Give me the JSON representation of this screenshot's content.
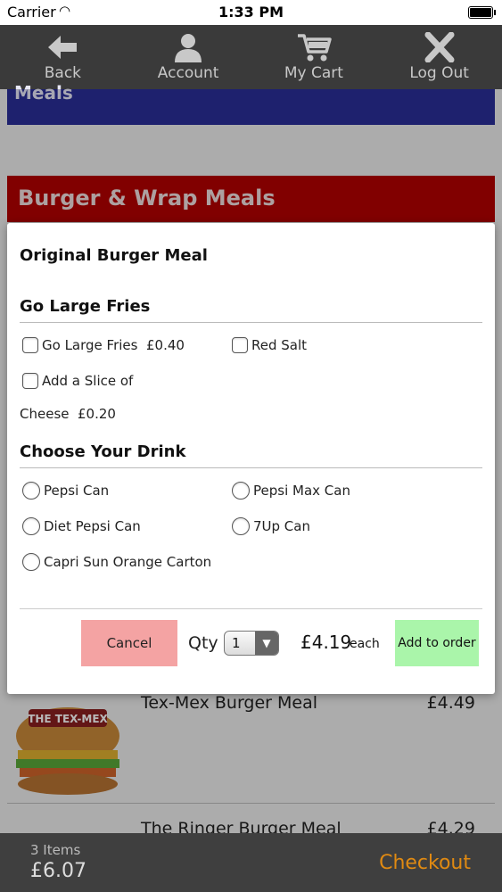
{
  "status_bar": {
    "carrier": "Carrier",
    "time": "1:33 PM"
  },
  "nav": {
    "back": "Back",
    "account": "Account",
    "cart": "My Cart",
    "logout": "Log Out"
  },
  "background": {
    "category_above": "Meals",
    "section_title": "Burger & Wrap Meals",
    "items": [
      {
        "name": "Tex-Mex Burger Meal",
        "price": "£4.49"
      },
      {
        "name": "The Ringer Burger Meal",
        "price": "£4.29"
      }
    ]
  },
  "modal": {
    "title": "Original Burger Meal",
    "groups": [
      {
        "title": "Go Large Fries",
        "options": [
          "Go Large Fries  £0.40",
          "Red Salt",
          "Add a Slice of",
          "Cheese  £0.20"
        ]
      },
      {
        "title": "Choose Your Drink",
        "options": [
          "Pepsi Can",
          "Pepsi Max Can",
          "Diet Pepsi Can",
          "7Up Can",
          "Capri Sun Orange Carton"
        ]
      }
    ],
    "cancel_label": "Cancel",
    "qty_label": "Qty",
    "qty_value": "1",
    "price": "£4.19",
    "price_suffix": "each",
    "add_label": "Add to order"
  },
  "cart_bar": {
    "items_text": "3 Items",
    "total": "£6.07",
    "checkout_label": "Checkout"
  },
  "colors": {
    "nav_bg": "#3a3a3a",
    "section_red": "#b30000",
    "meals_blue": "#2a2f99",
    "cancel_pink": "#f4a3a3",
    "add_green": "#aaf5aa",
    "checkout_orange": "#e08a12"
  }
}
